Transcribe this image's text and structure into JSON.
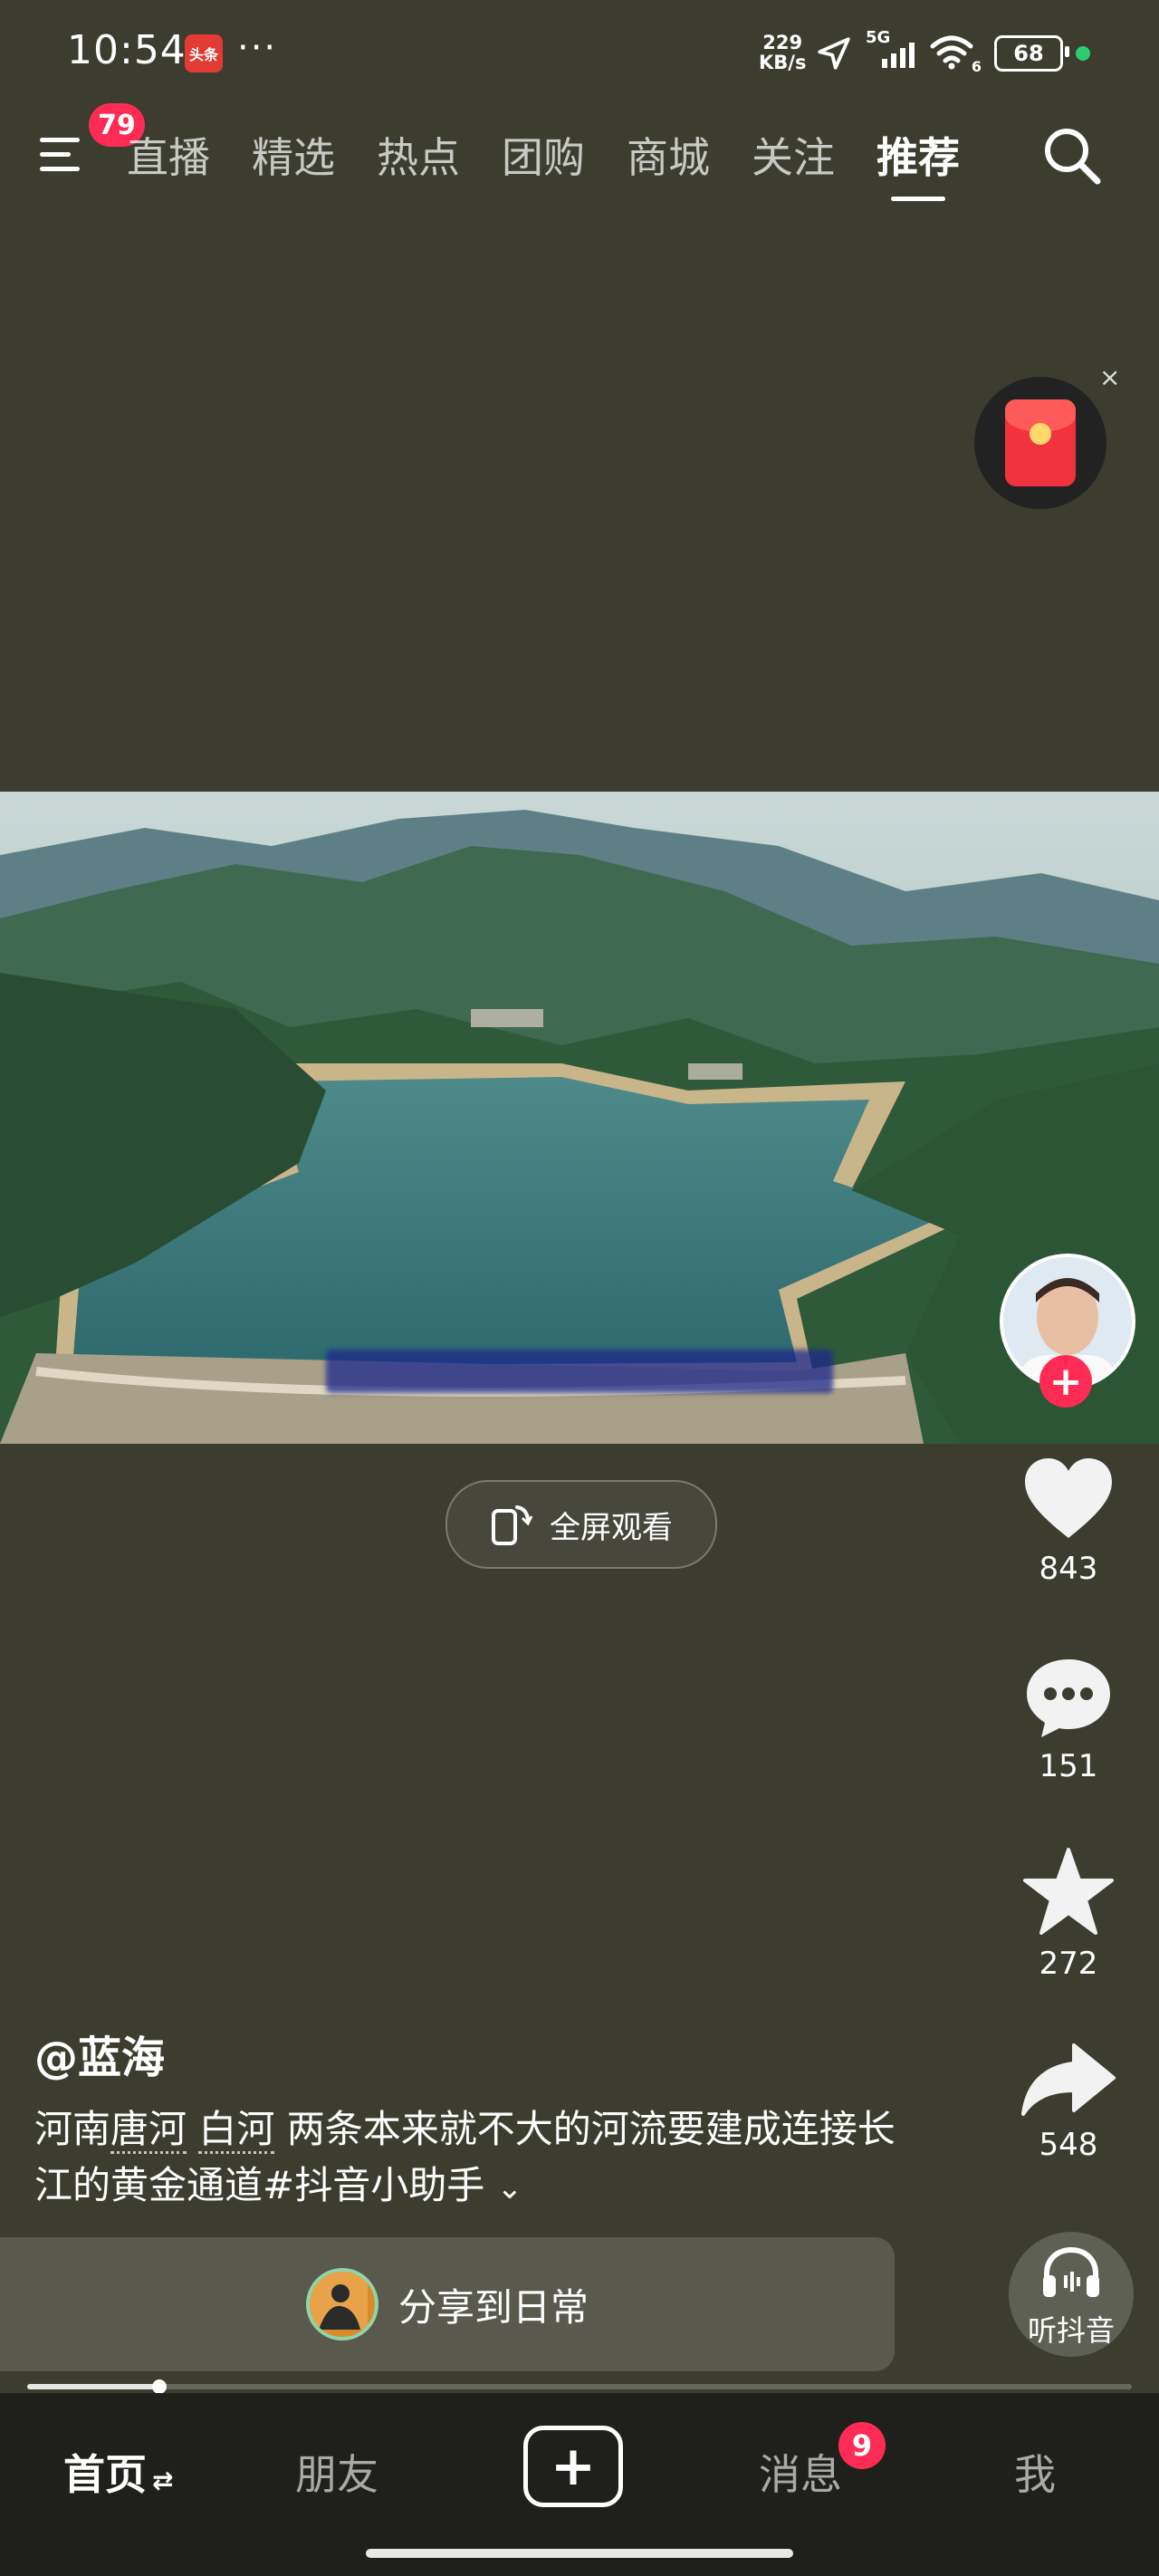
{
  "status_bar": {
    "time": "10:54",
    "app_badge": "头条",
    "more": "···",
    "net_speed_value": "229",
    "net_speed_unit": "KB/s",
    "signal_label": "5G",
    "wifi_label": "6",
    "battery": "68"
  },
  "top_nav": {
    "notification_count": "79",
    "tabs": [
      {
        "label": "直播",
        "active": false
      },
      {
        "label": "精选",
        "active": false
      },
      {
        "label": "热点",
        "active": false
      },
      {
        "label": "团购",
        "active": false
      },
      {
        "label": "商城",
        "active": false
      },
      {
        "label": "关注",
        "active": false
      },
      {
        "label": "推荐",
        "active": true
      }
    ]
  },
  "red_packet": {
    "close": "×"
  },
  "video": {
    "fullscreen_label": "全屏观看"
  },
  "actions": {
    "like_count": "843",
    "comment_count": "151",
    "favorite_count": "272",
    "share_count": "548",
    "listen_label": "听抖音"
  },
  "post": {
    "author": "@蓝海",
    "desc_part1": "河南",
    "desc_tag1": "唐河",
    "desc_space": " ",
    "desc_tag2": "白河",
    "desc_part2": " 两条本来就不大的河流要建成连接长江的黄金通道#抖音小助手",
    "expand": "⌄"
  },
  "share_bar": {
    "label": "分享到日常"
  },
  "playback": {
    "progress": 0.12
  },
  "bottom_nav": {
    "home": "首页",
    "home_switch": "⇄",
    "friends": "朋友",
    "create": "+",
    "messages": "消息",
    "messages_badge": "9",
    "me": "我"
  },
  "colors": {
    "background": "#3c3d2f",
    "accent": "#fe2c55",
    "bottom_nav_bg": "#1f201b"
  }
}
